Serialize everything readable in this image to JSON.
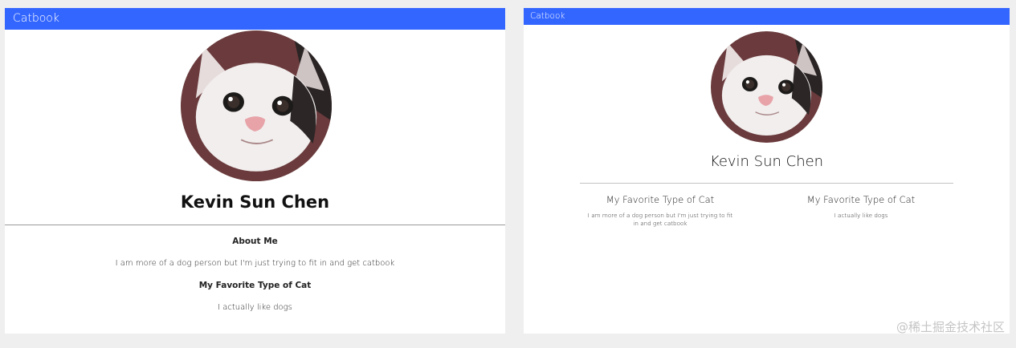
{
  "left": {
    "navbar": {
      "title": "Catbook"
    },
    "profile": {
      "name": "Kevin Sun Chen",
      "about_title": "About Me",
      "about_text": "I am more of a dog person but I'm just trying to fit in and get catbook",
      "favorite_title": "My Favorite Type of Cat",
      "favorite_text": "I actually like dogs"
    }
  },
  "right": {
    "navbar": {
      "title": "Catbook"
    },
    "profile": {
      "name": "Kevin Sun Chen",
      "col1_title": "My Favorite Type of Cat",
      "col1_text": "I am more of a dog person but I'm just trying to fit in and get catbook",
      "col2_title": "My Favorite Type of Cat",
      "col2_text": "I actually like dogs"
    }
  },
  "watermark": "@稀土掘金技术社区",
  "colors": {
    "navbar_bg": "#3366ff",
    "page_bg": "#efefef",
    "panel_bg": "#ffffff"
  }
}
